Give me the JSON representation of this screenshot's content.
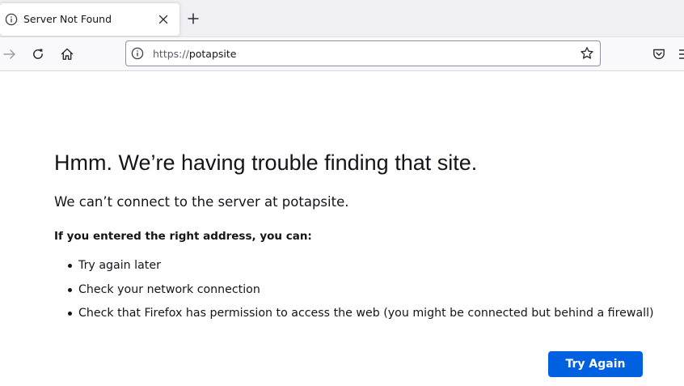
{
  "tab": {
    "title": "Server Not Found",
    "icon": "info-icon"
  },
  "toolbar": {
    "url_scheme": "https://",
    "url_host": "potapsite"
  },
  "error": {
    "title": "Hmm. We’re having trouble finding that site.",
    "description": "We can’t connect to the server at potapsite.",
    "hint": "If you entered the right address, you can:",
    "suggestions": [
      "Try again later",
      "Check your network connection",
      "Check that Firefox has permission to access the web (you might be connected but behind a firewall)"
    ],
    "button_label": "Try Again"
  },
  "colors": {
    "accent": "#0061e0",
    "chrome_bg": "#f0f0f4",
    "text": "#15141a"
  }
}
